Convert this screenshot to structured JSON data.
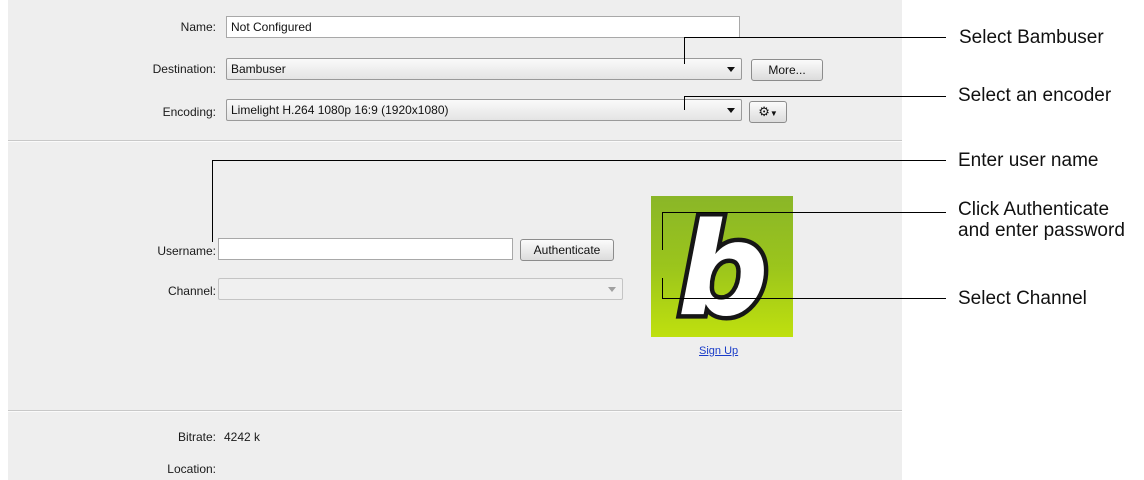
{
  "form": {
    "name_label": "Name:",
    "name_value": "Not Configured",
    "destination_label": "Destination:",
    "destination_value": "Bambuser",
    "more_button": "More...",
    "encoding_label": "Encoding:",
    "encoding_value": "Limelight H.264 1080p 16:9 (1920x1080)",
    "settings_icon": "gear-icon"
  },
  "auth": {
    "username_label": "Username:",
    "username_value": "",
    "authenticate_button": "Authenticate",
    "channel_label": "Channel:",
    "channel_value": "",
    "logo_letter": "b",
    "signup_link": "Sign Up"
  },
  "info": {
    "bitrate_label": "Bitrate:",
    "bitrate_value": "4242 k",
    "location_label": "Location:",
    "location_value": ""
  },
  "callouts": [
    "Select Bambuser",
    "Select an encoder",
    "Enter user name",
    "Click Authenticate and enter password",
    "Select Channel"
  ],
  "colors": {
    "panel": "#eeeeee",
    "logo_top": "#8ab628",
    "logo_bottom": "#bfe00e",
    "link": "#1a3cc8"
  }
}
